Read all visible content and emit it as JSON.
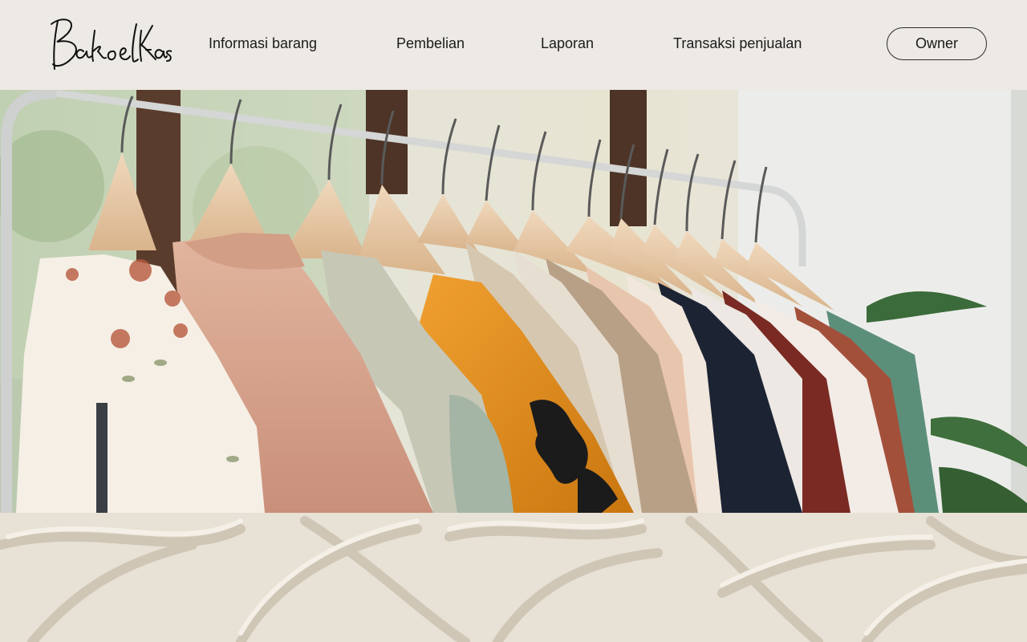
{
  "brand": {
    "logo_text": "BakoelKaos"
  },
  "nav": {
    "items": [
      {
        "label": "Informasi barang"
      },
      {
        "label": "Pembelian"
      },
      {
        "label": "Laporan"
      },
      {
        "label": "Transaksi penjualan"
      }
    ],
    "owner_label": "Owner"
  },
  "hero": {
    "image": "clothing-rack-photo",
    "accent_colors": {
      "mustard": "#e08a1c",
      "blush": "#d9a891",
      "navy": "#1c2333",
      "maroon": "#7a2a22"
    }
  },
  "footer_banner": {
    "image": "carved-stone-relief"
  }
}
